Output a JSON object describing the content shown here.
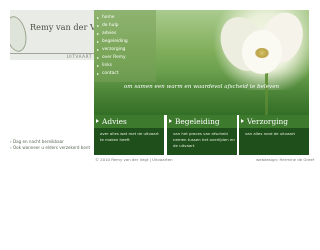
{
  "logo": {
    "title": "Remy van der Vegt",
    "subtitle": "UITVAART"
  },
  "nav": {
    "items": [
      {
        "label": "home"
      },
      {
        "label": "de hulp"
      },
      {
        "label": "advies"
      },
      {
        "label": "begeleiding"
      },
      {
        "label": "verzorging"
      },
      {
        "label": "over Remy"
      },
      {
        "label": "links"
      },
      {
        "label": "contact"
      }
    ]
  },
  "hero": {
    "slogan": "om samen een warm en waardevol afscheid te beleven"
  },
  "columns": [
    {
      "title": "Advies",
      "text": "over alles wat met de uitvaart te maken heeft"
    },
    {
      "title": "Begeleiding",
      "text": "van het proces van afscheid nemen tussen het overlijden en de uitvaart"
    },
    {
      "title": "Verzorging",
      "text": "van alles rond de uitvaart"
    }
  ],
  "side_links": [
    {
      "label": "Dag en nacht bereikbaar"
    },
    {
      "label": "Ook wanneer u elders verzekerd bent"
    }
  ],
  "footer": {
    "copyright": "© 2010 Remy van der Vegt | Uitvaarten",
    "credit": "webdesign: Hermine de Greef"
  },
  "colors": {
    "accent": "#3d7a2e",
    "dark": "#1f4f1b"
  }
}
